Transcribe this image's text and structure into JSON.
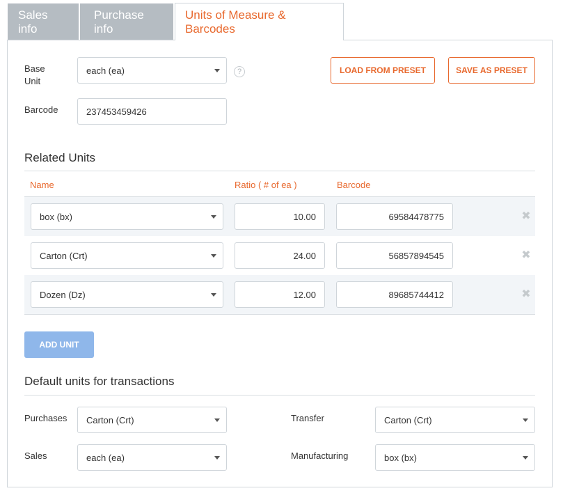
{
  "tabs": [
    {
      "label": "Sales info"
    },
    {
      "label": "Purchase info"
    },
    {
      "label": "Units of Measure & Barcodes"
    }
  ],
  "base_unit": {
    "label_line1": "Base",
    "label_line2": "Unit",
    "value": "each (ea)",
    "help": "?"
  },
  "barcode": {
    "label": "Barcode",
    "value": "237453459426"
  },
  "buttons": {
    "load_preset": "LOAD FROM PRESET",
    "save_preset": "SAVE AS PRESET",
    "add_unit": "ADD UNIT"
  },
  "related_units": {
    "title": "Related Units",
    "columns": {
      "name": "Name",
      "ratio": "Ratio ( # of ea )",
      "barcode": "Barcode"
    },
    "rows": [
      {
        "name": "box (bx)",
        "ratio": "10.00",
        "barcode": "69584478775",
        "remove": "✖"
      },
      {
        "name": "Carton (Crt)",
        "ratio": "24.00",
        "barcode": "56857894545",
        "remove": "✖"
      },
      {
        "name": "Dozen (Dz)",
        "ratio": "12.00",
        "barcode": "89685744412",
        "remove": "✖"
      }
    ]
  },
  "defaults": {
    "title": "Default units for transactions",
    "purchases": {
      "label": "Purchases",
      "value": "Carton (Crt)"
    },
    "sales": {
      "label": "Sales",
      "value": "each (ea)"
    },
    "transfer": {
      "label": "Transfer",
      "value": "Carton (Crt)"
    },
    "manufacturing": {
      "label": "Manufacturing",
      "value": "box (bx)"
    }
  },
  "colors": {
    "accent": "#e8692e",
    "primary_button": "#8fb7ea",
    "tab_inactive": "#b5bcc2"
  }
}
